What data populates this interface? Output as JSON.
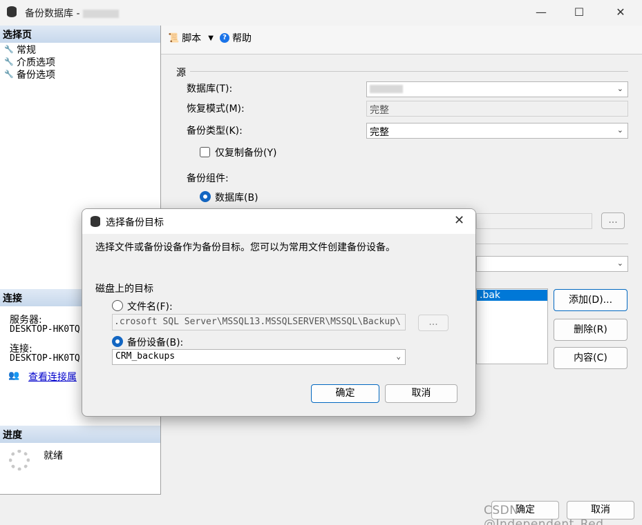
{
  "window": {
    "title": "备份数据库 -",
    "minimize": "—",
    "maximize": "☐",
    "close": "✕"
  },
  "left_pane": {
    "select_page_header": "选择页",
    "pages": [
      {
        "label": "常规"
      },
      {
        "label": "介质选项"
      },
      {
        "label": "备份选项"
      }
    ],
    "connection_header": "连接",
    "server_label": "服务器:",
    "server_value": "DESKTOP-HK0TQ",
    "connection_label": "连接:",
    "connection_value": "DESKTOP-HK0TQ",
    "view_props_link": "查看连接属",
    "progress_header": "进度",
    "progress_status": "就绪"
  },
  "toolbar": {
    "script_label": "脚本",
    "help_label": "帮助"
  },
  "source": {
    "group_label": "源",
    "database_label": "数据库(T):",
    "recovery_label": "恢复模式(M):",
    "recovery_value": "完整",
    "backup_type_label": "备份类型(K):",
    "backup_type_value": "完整",
    "copy_only_label": "仅复制备份(Y)",
    "component_label": "备份组件:",
    "component_database_label": "数据库(B)"
  },
  "destination": {
    "browse_label": "...",
    "list_item": ".bak",
    "add_label": "添加(D)...",
    "remove_label": "删除(R)",
    "contents_label": "内容(C)"
  },
  "footer": {
    "ok_label": "确定",
    "cancel_label": "取消"
  },
  "dialog": {
    "title": "选择备份目标",
    "close": "✕",
    "instruction": "选择文件或备份设备作为备份目标。您可以为常用文件创建备份设备。",
    "disk_group_label": "磁盘上的目标",
    "file_name_label": "文件名(F):",
    "file_name_value": ".crosoft SQL Server\\MSSQL13.MSSQLSERVER\\MSSQL\\Backup\\",
    "browse_label": "...",
    "backup_device_label": "备份设备(B):",
    "backup_device_value": "CRM_backups",
    "ok_label": "确定",
    "cancel_label": "取消"
  },
  "watermark": "CSDN @Independent_Red"
}
